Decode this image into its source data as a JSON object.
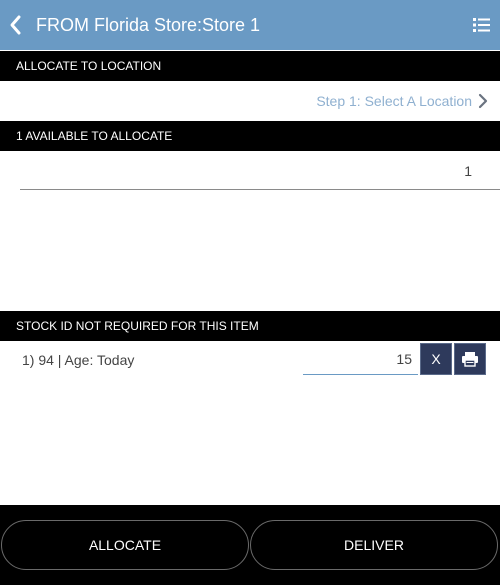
{
  "header": {
    "title": "FROM Florida Store:Store 1",
    "back_icon": "chevron-left-icon",
    "menu_icon": "list-icon",
    "background": "#6a9ac4"
  },
  "allocate_section": {
    "title": "ALLOCATE TO LOCATION",
    "step_link": "Step 1: Select A Location",
    "step_icon": "chevron-right-icon"
  },
  "available_section": {
    "title": "1 AVAILABLE TO ALLOCATE",
    "quantity": "1"
  },
  "stock_section": {
    "title": "STOCK ID NOT REQUIRED FOR THIS ITEM",
    "items": [
      {
        "label": "1) 94 | Age: Today",
        "quantity": "15",
        "remove_label": "X",
        "print_icon": "printer-icon"
      }
    ]
  },
  "footer": {
    "allocate_label": "ALLOCATE",
    "deliver_label": "DELIVER"
  }
}
